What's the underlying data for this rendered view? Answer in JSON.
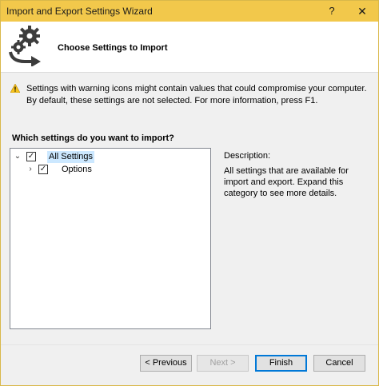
{
  "window": {
    "title": "Import and Export Settings Wizard",
    "help_glyph": "?",
    "close_glyph": "✕",
    "accent_color": "#f2c84b"
  },
  "header": {
    "heading": "Choose Settings to Import",
    "icon": "gears-arrow-icon"
  },
  "warning": {
    "icon": "warning-icon",
    "text": "Settings with warning icons might contain values that could compromise your computer. By default, these settings are not selected. For more information, press F1."
  },
  "question": "Which settings do you want to import?",
  "tree": {
    "items": [
      {
        "label": "All Settings",
        "checked": true,
        "expanded": true,
        "selected": true
      },
      {
        "label": "Options",
        "checked": true,
        "expanded": false,
        "selected": false
      }
    ],
    "expanded_glyph": "⌄",
    "collapsed_glyph": "›",
    "check_glyph": "✓"
  },
  "description": {
    "label": "Description:",
    "text": "All settings that are available for import and export. Expand this category to see more details."
  },
  "buttons": {
    "previous": "< Previous",
    "next": "Next >",
    "finish": "Finish",
    "cancel": "Cancel"
  }
}
